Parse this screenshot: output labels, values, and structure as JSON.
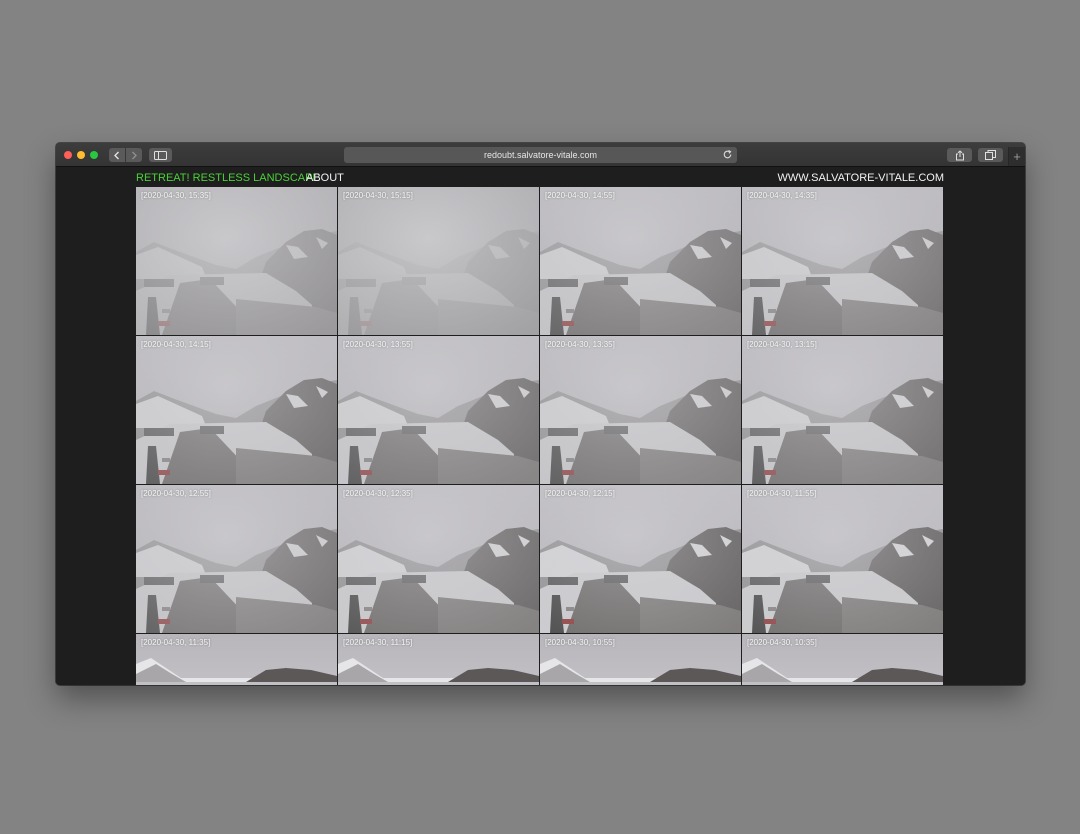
{
  "browser": {
    "address": "redoubt.salvatore-vitale.com",
    "new_tab_label": "+"
  },
  "site": {
    "brand": "RETREAT! RESTLESS LANDSCAPE",
    "about": "ABOUT",
    "url": "WWW.SALVATORE-VITALE.COM",
    "brand_color": "#4cd13a"
  },
  "tiles": [
    {
      "timestamp": "[2020-04-30, 15:35]",
      "fog": 0.75
    },
    {
      "timestamp": "[2020-04-30, 15:15]",
      "fog": 0.92
    },
    {
      "timestamp": "[2020-04-30, 14:55]",
      "fog": 0.35
    },
    {
      "timestamp": "[2020-04-30, 14:35]",
      "fog": 0.35
    },
    {
      "timestamp": "[2020-04-30, 14:15]",
      "fog": 0.28
    },
    {
      "timestamp": "[2020-04-30, 13:55]",
      "fog": 0.28
    },
    {
      "timestamp": "[2020-04-30, 13:35]",
      "fog": 0.28
    },
    {
      "timestamp": "[2020-04-30, 13:15]",
      "fog": 0.28
    },
    {
      "timestamp": "[2020-04-30, 12:55]",
      "fog": 0.32
    },
    {
      "timestamp": "[2020-04-30, 12:35]",
      "fog": 0.2
    },
    {
      "timestamp": "[2020-04-30, 12:15]",
      "fog": 0.12
    },
    {
      "timestamp": "[2020-04-30, 11:55]",
      "fog": 0.15
    },
    {
      "timestamp": "[2020-04-30, 11:35]",
      "fog": 0.1
    },
    {
      "timestamp": "[2020-04-30, 11:15]",
      "fog": 0.1
    },
    {
      "timestamp": "[2020-04-30, 10:55]",
      "fog": 0.1
    },
    {
      "timestamp": "[2020-04-30, 10:35]",
      "fog": 0.1
    }
  ]
}
